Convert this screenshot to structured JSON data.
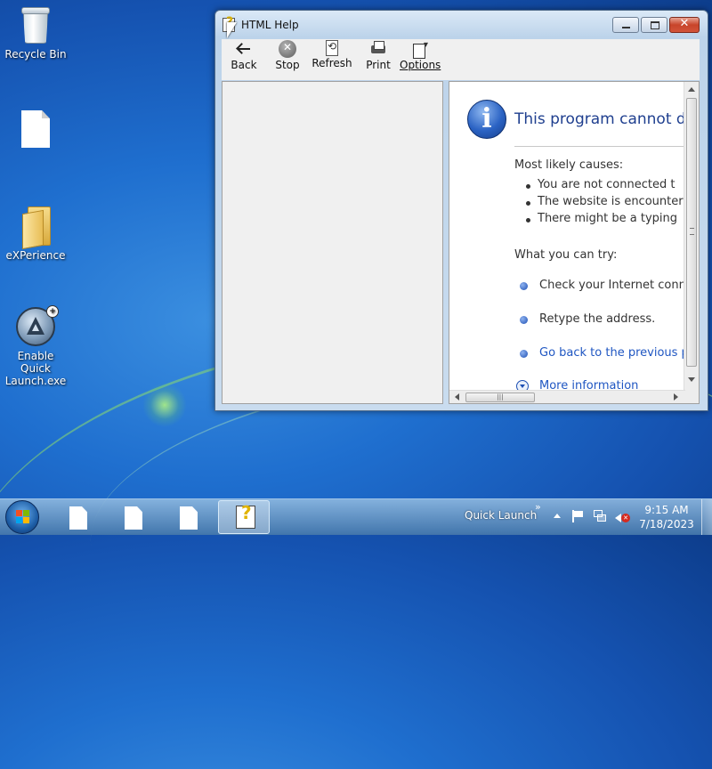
{
  "desktop": {
    "icons": [
      {
        "label": "Recycle Bin",
        "icon": "recycle-bin-icon"
      },
      {
        "label": "",
        "icon": "document-icon"
      },
      {
        "label": "eXPerience",
        "icon": "folder-icon"
      },
      {
        "label": "Enable Quick Launch.exe",
        "icon": "aquasoft-app-icon"
      }
    ]
  },
  "window": {
    "title": "HTML Help",
    "toolbar": {
      "back": "Back",
      "stop": "Stop",
      "refresh": "Refresh",
      "print": "Print",
      "options": "Options"
    },
    "error_page": {
      "title": "This program cannot dis",
      "causes_heading": "Most likely causes:",
      "causes": [
        "You are not connected t",
        "The website is encounter",
        "There might be a typing"
      ],
      "try_heading": "What you can try:",
      "try_items": [
        {
          "text": "Check your Internet conne",
          "link": false
        },
        {
          "text": "Retype the address.",
          "link": false
        },
        {
          "text": "Go back to the previous pa",
          "link": true
        }
      ],
      "more_info": "More information"
    }
  },
  "taskbar": {
    "quick_launch_label": "Quick Launch",
    "overflow_chevron": "»",
    "clock_time": "9:15 AM",
    "clock_date": "7/18/2023"
  },
  "colors": {
    "desktop_blue": "#1f6fcf",
    "link_blue": "#1f56c2",
    "title_blue": "#1f3f8f",
    "close_red": "#c8442a"
  }
}
